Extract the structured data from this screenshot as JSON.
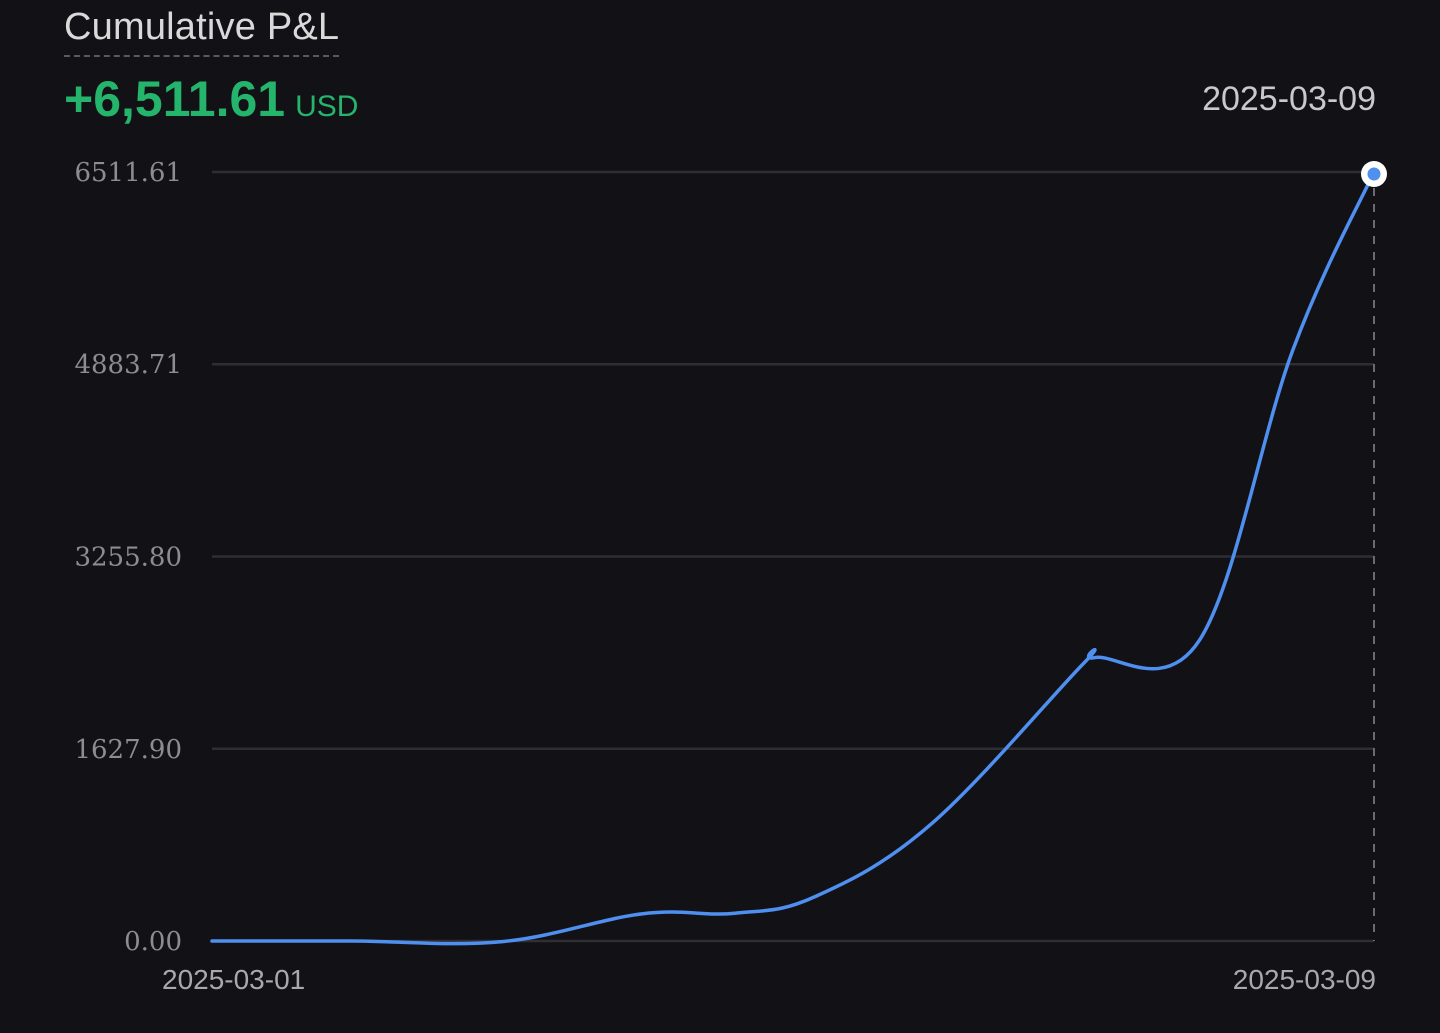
{
  "header": {
    "title": "Cumulative P&L",
    "value": "+6,511.61",
    "unit": "USD",
    "selected_date": "2025-03-09"
  },
  "colors": {
    "background": "#111116",
    "positive": "#25b46b",
    "line": "#4f8ff0",
    "grid": "#2e2e33"
  },
  "chart_data": {
    "type": "line",
    "x_start_label": "2025-03-01",
    "x_end_label": "2025-03-09",
    "y_ticks": [
      "0.00",
      "1627.90",
      "3255.80",
      "4883.71",
      "6511.61"
    ],
    "ylim": [
      0,
      6511.61
    ],
    "grid": true,
    "series": [
      {
        "x": [
          0,
          0.12,
          0.25,
          0.37,
          0.45,
          0.52,
          0.62,
          0.75,
          0.76,
          0.85,
          0.93,
          1.0
        ],
        "values": [
          0,
          0,
          -5,
          230,
          235,
          380,
          1000,
          2350,
          2400,
          2550,
          5000,
          6511.61
        ]
      }
    ],
    "highlight_point": {
      "date": "2025-03-09",
      "value": 6511.61
    }
  }
}
